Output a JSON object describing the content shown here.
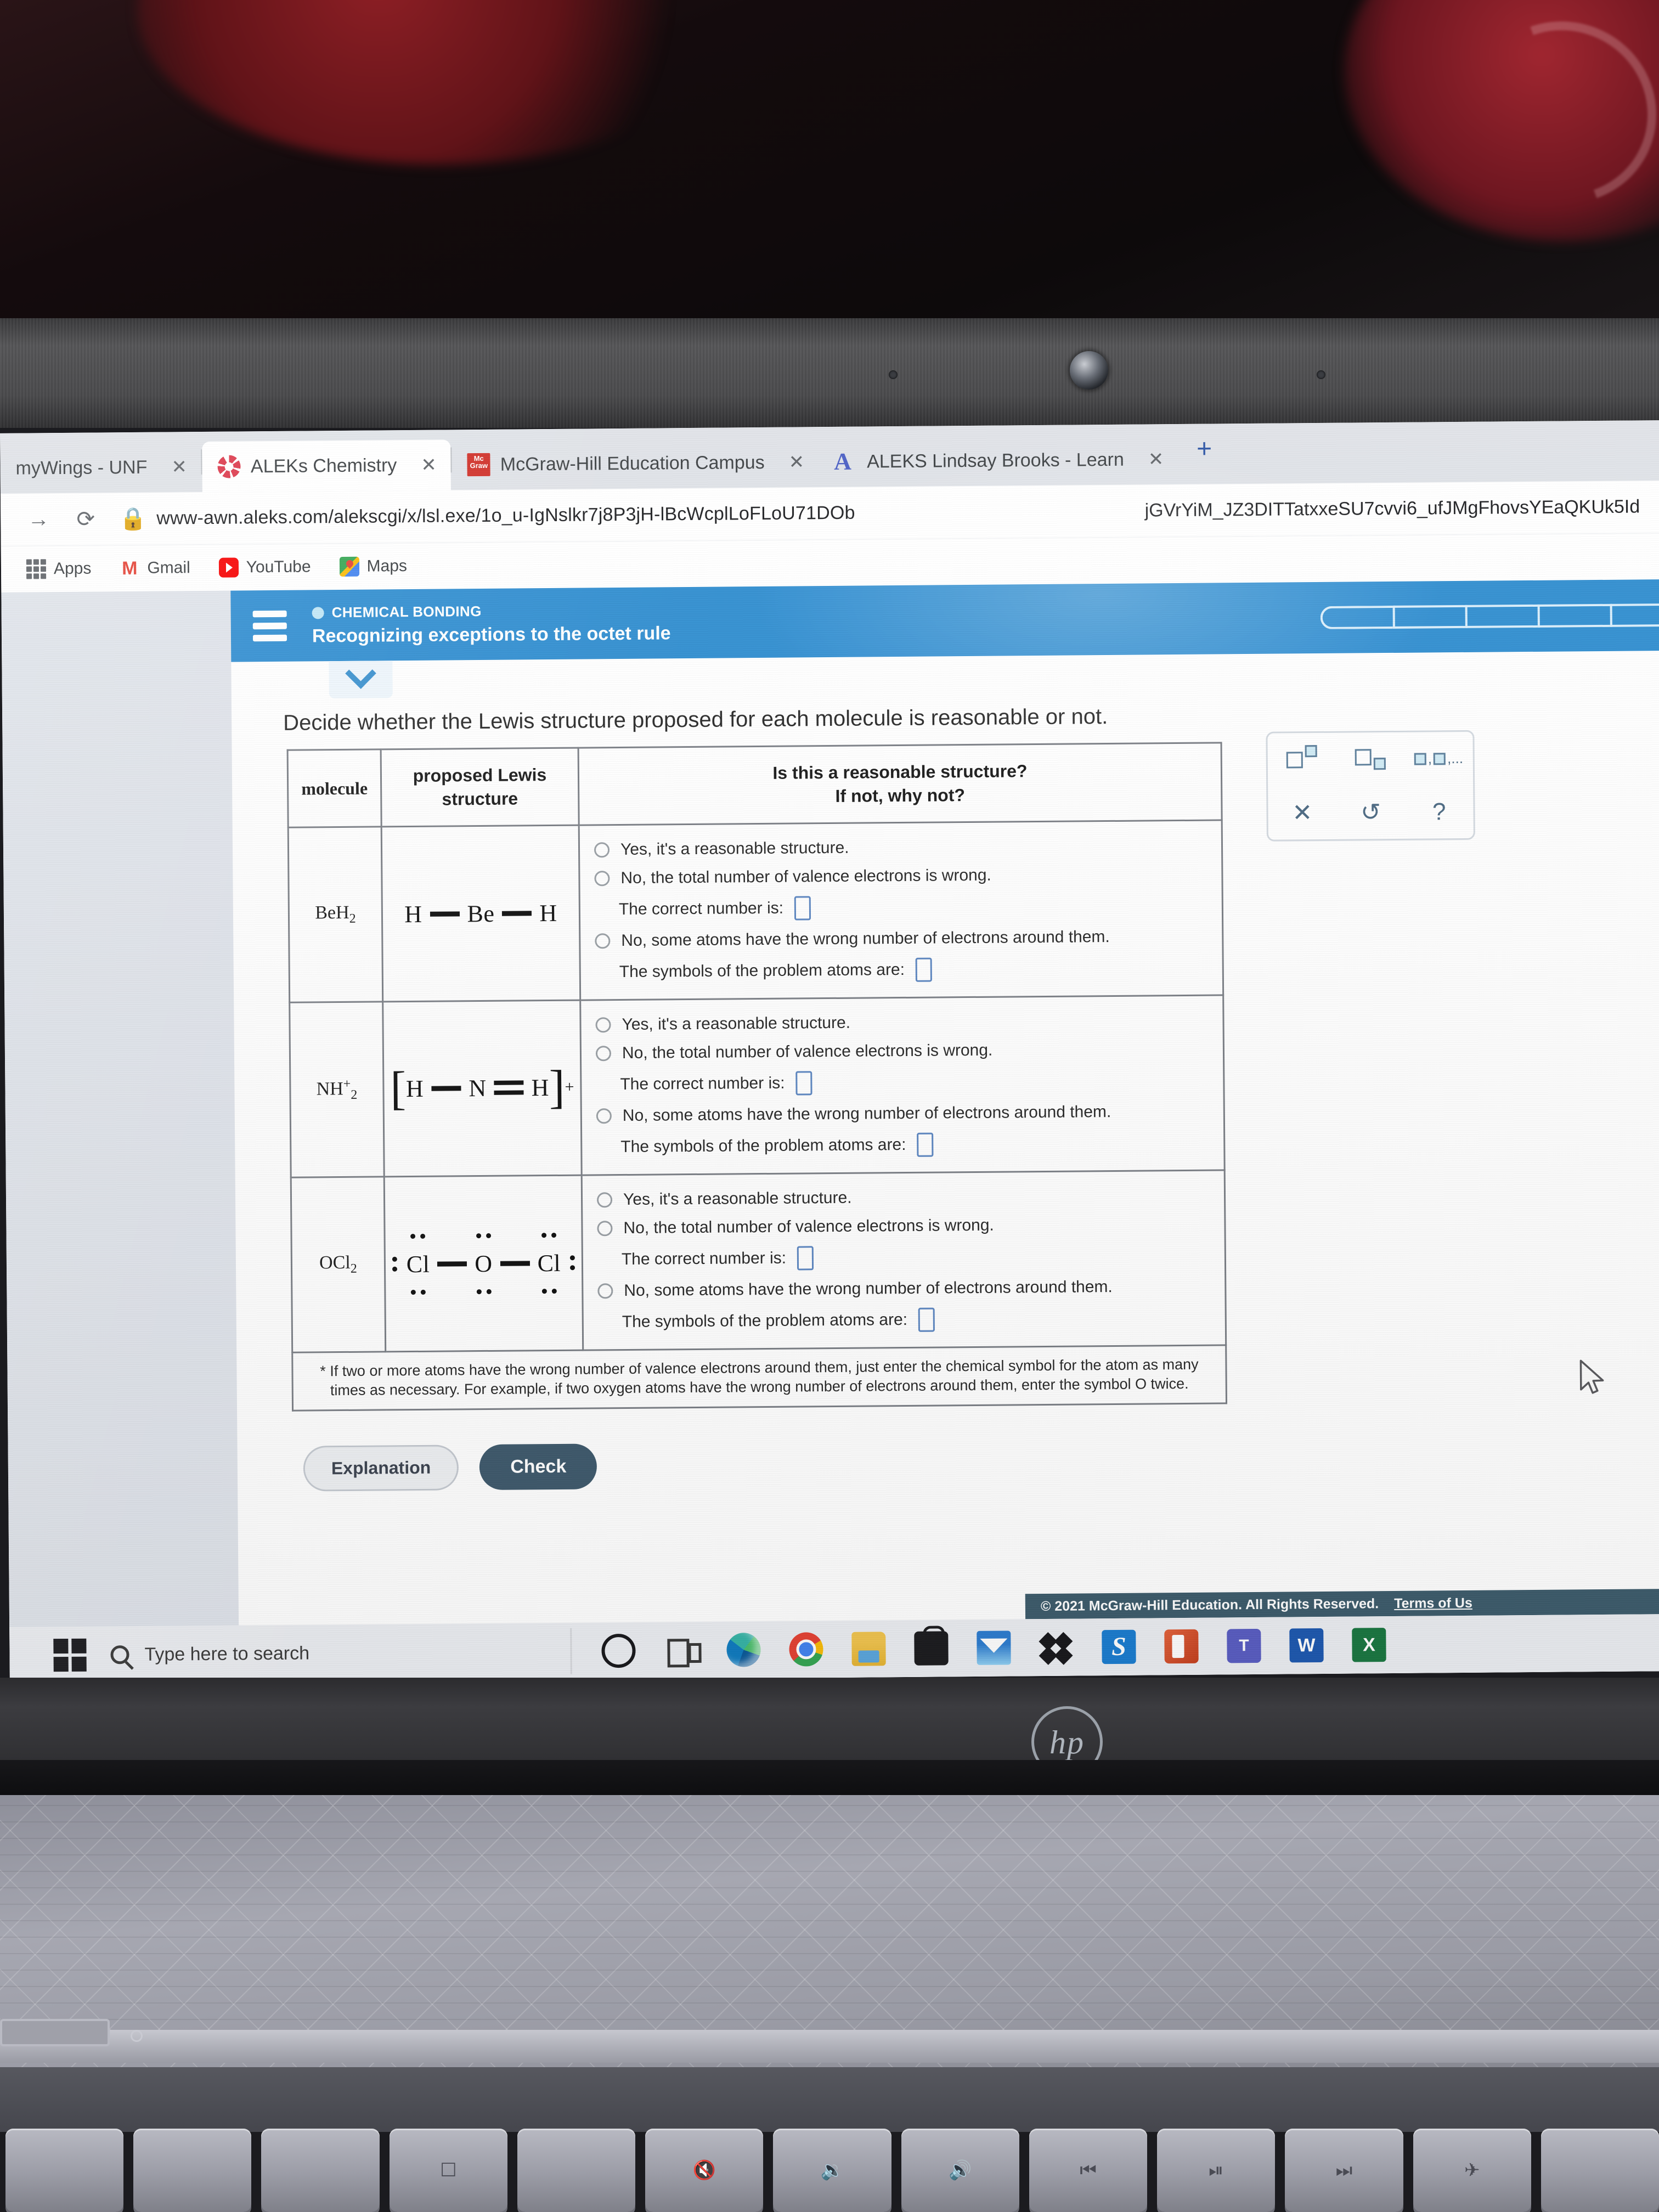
{
  "browser": {
    "tabs": [
      {
        "title": "myWings - UNF",
        "favicon": "none-icon",
        "close": "✕",
        "active": false
      },
      {
        "title": "ALEKs Chemistry",
        "favicon": "aleks-icon",
        "close": "✕",
        "active": true
      },
      {
        "title": "McGraw-Hill Education Campus",
        "favicon": "mcgraw-hill-icon",
        "close": "✕",
        "active": false
      },
      {
        "title": "ALEKS  Lindsay Brooks - Learn",
        "favicon": "aleks-a-icon",
        "close": "✕",
        "active": false
      }
    ],
    "new_tab_label": "+",
    "omnibox": {
      "forward_icon": "→",
      "reload_icon": "⟳",
      "lock_icon": "🔒",
      "url": "www-awn.aleks.com/alekscgi/x/lsl.exe/1o_u-IgNslkr7j8P3jH-lBcWcplLoFLoU71DOb",
      "url_tail": "jGVrYiM_JZ3DITTatxxeSU7cvvi6_ufJMgFhovsYEaQKUk5Id"
    },
    "bookmarks": [
      {
        "label": "Apps",
        "icon": "apps-grid-icon"
      },
      {
        "label": "Gmail",
        "icon": "gmail-icon"
      },
      {
        "label": "YouTube",
        "icon": "youtube-icon"
      },
      {
        "label": "Maps",
        "icon": "maps-icon"
      }
    ]
  },
  "aleks": {
    "header": {
      "menu_icon": "hamburger-icon",
      "kicker": "CHEMICAL BONDING",
      "title": "Recognizing exceptions to the octet rule",
      "progress_segments": 5,
      "bar_color": "#2e8fd4"
    },
    "collapse_icon": "chevron-down-icon",
    "prompt": "Decide whether the Lewis structure proposed for each molecule is reasonable or not.",
    "table": {
      "headers": {
        "molecule": "molecule",
        "lewis": "proposed Lewis\nstructure",
        "question_line1": "Is this a reasonable structure?",
        "question_line2": "If not, why not?"
      },
      "options": {
        "yes": "Yes, it's a reasonable structure.",
        "no_valence": "No, the total number of valence electrons is wrong.",
        "correct_number_label": "The correct number is:",
        "no_atoms": "No, some atoms have the wrong number of electrons around them.",
        "symbols_label": "The symbols of the problem atoms are:"
      },
      "rows": [
        {
          "molecule_main": "BeH",
          "molecule_sub": "2",
          "molecule_charge": "",
          "lewis_type": "beh2",
          "correct_number_value": "",
          "symbols_value": "",
          "selected": ""
        },
        {
          "molecule_main": "NH",
          "molecule_sub": "2",
          "molecule_charge": "+",
          "lewis_type": "nh2plus",
          "correct_number_value": "",
          "symbols_value": "",
          "selected": ""
        },
        {
          "molecule_main": "OCl",
          "molecule_sub": "2",
          "molecule_charge": "",
          "lewis_type": "ocl2",
          "correct_number_value": "",
          "symbols_value": "",
          "selected": ""
        }
      ],
      "footnote": "* If two or more atoms have the wrong number of valence electrons around them, just enter the chemical symbol for the atom as many times as necessary. For example, if two oxygen atoms have the wrong number of electrons around them, enter the symbol O twice."
    },
    "palette": {
      "superscript_icon": "superscript-icon",
      "subscript_icon": "subscript-icon",
      "list_icon": "comma-list-icon",
      "list_label": ",...",
      "clear_icon": "✕",
      "undo_icon": "↺",
      "help_icon": "?"
    },
    "buttons": {
      "explanation": "Explanation",
      "check": "Check"
    },
    "copyright": "© 2021 McGraw-Hill Education. All Rights Reserved.",
    "terms_link": "Terms of Us"
  },
  "taskbar": {
    "start_icon": "windows-start-icon",
    "search_placeholder": "Type here to search",
    "cortana_icon": "cortana-circle-icon",
    "taskview_icon": "task-view-icon",
    "apps": [
      {
        "name": "edge-icon",
        "glyph": ""
      },
      {
        "name": "chrome-icon",
        "glyph": ""
      },
      {
        "name": "file-explorer-icon",
        "glyph": ""
      },
      {
        "name": "microsoft-store-icon",
        "glyph": ""
      },
      {
        "name": "mail-icon",
        "glyph": ""
      },
      {
        "name": "dropbox-icon",
        "glyph": ""
      },
      {
        "name": "skype-icon",
        "glyph": "S"
      },
      {
        "name": "office-icon",
        "glyph": ""
      },
      {
        "name": "teams-icon",
        "glyph": "T"
      },
      {
        "name": "word-icon",
        "glyph": "W"
      },
      {
        "name": "excel-icon",
        "glyph": "X"
      }
    ]
  },
  "laptop": {
    "brand": "hp",
    "function_keys": [
      "🔇",
      "🔉",
      "🔊",
      "⏮",
      "⏯",
      "⏭",
      "✈"
    ]
  }
}
